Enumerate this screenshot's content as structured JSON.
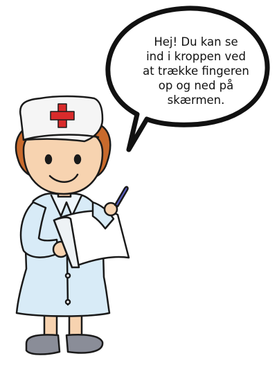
{
  "speech_bubble": {
    "lines": [
      "Hej! Du kan se",
      "ind i kroppen ved",
      "at trække fingeren",
      "op og ned på",
      "skærmen."
    ]
  },
  "colors": {
    "outline": "#1a1a1a",
    "skin": "#f7d3b0",
    "hair": "#c86a2c",
    "uniform": "#d8ebf7",
    "cross": "#d92b2b",
    "shoes": "#8a8d98",
    "pen": "#5a5fc8"
  },
  "icons": [
    "nurse-character-icon",
    "red-cross-icon",
    "clipboard-icon",
    "pen-icon"
  ]
}
